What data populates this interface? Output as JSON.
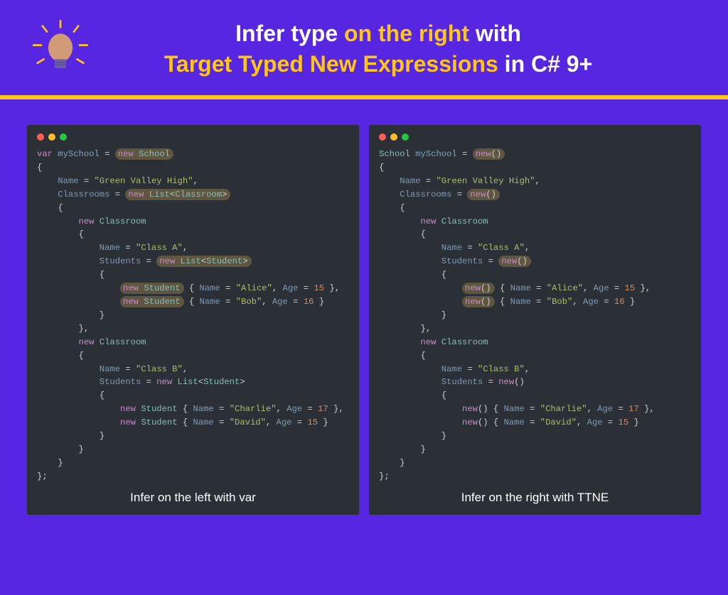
{
  "title": {
    "line1_a": "Infer type ",
    "line1_b": "on the right ",
    "line1_c": "with",
    "line2_a": "Target Typed New Expressions ",
    "line2_b": "in C# 9+"
  },
  "left": {
    "caption": "Infer on the left with var",
    "code": {
      "l1_var": "var",
      "l1_name": "mySchool",
      "l1_eq": " = ",
      "l1_hl_new": "new",
      "l1_hl_type": "School",
      "l3_name": "Name",
      "l3_val": "\"Green Valley High\"",
      "l4_name": "Classrooms",
      "l4_hl_new": "new",
      "l4_hl_type": "List",
      "l4_hl_gen": "Classroom",
      "l6_new": "new",
      "l6_type": "Classroom",
      "l8_name": "Name",
      "l8_val": "\"Class A\"",
      "l9_name": "Students",
      "l9_hl_new": "new",
      "l9_hl_type": "List",
      "l9_hl_gen": "Student",
      "l11_hl_new": "new",
      "l11_hl_type": "Student",
      "l11_name": "Name",
      "l11_val": "\"Alice\"",
      "l11_age": "Age",
      "l11_num": "15",
      "l12_hl_new": "new",
      "l12_hl_type": "Student",
      "l12_name": "Name",
      "l12_val": "\"Bob\"",
      "l12_age": "Age",
      "l12_num": "16",
      "l15_new": "new",
      "l15_type": "Classroom",
      "l17_name": "Name",
      "l17_val": "\"Class B\"",
      "l18_name": "Students",
      "l18_new": "new",
      "l18_type": "List",
      "l18_gen": "Student",
      "l20_new": "new",
      "l20_type": "Student",
      "l20_name": "Name",
      "l20_val": "\"Charlie\"",
      "l20_age": "Age",
      "l20_num": "17",
      "l21_new": "new",
      "l21_type": "Student",
      "l21_name": "Name",
      "l21_val": "\"David\"",
      "l21_age": "Age",
      "l21_num": "15"
    }
  },
  "right": {
    "caption": "Infer on the right with TTNE",
    "code": {
      "l1_type": "School",
      "l1_name": "mySchool",
      "l1_eq": " = ",
      "l1_hl_new": "new",
      "l3_name": "Name",
      "l3_val": "\"Green Valley High\"",
      "l4_name": "Classrooms",
      "l4_hl_new": "new",
      "l6_new": "new",
      "l6_type": "Classroom",
      "l8_name": "Name",
      "l8_val": "\"Class A\"",
      "l9_name": "Students",
      "l9_hl_new": "new",
      "l11_hl_new": "new",
      "l11_name": "Name",
      "l11_val": "\"Alice\"",
      "l11_age": "Age",
      "l11_num": "15",
      "l12_hl_new": "new",
      "l12_name": "Name",
      "l12_val": "\"Bob\"",
      "l12_age": "Age",
      "l12_num": "16",
      "l15_new": "new",
      "l15_type": "Classroom",
      "l17_name": "Name",
      "l17_val": "\"Class B\"",
      "l18_name": "Students",
      "l18_new": "new",
      "l20_new": "new",
      "l20_name": "Name",
      "l20_val": "\"Charlie\"",
      "l20_age": "Age",
      "l20_num": "17",
      "l21_new": "new",
      "l21_name": "Name",
      "l21_val": "\"David\"",
      "l21_age": "Age",
      "l21_num": "15"
    }
  }
}
